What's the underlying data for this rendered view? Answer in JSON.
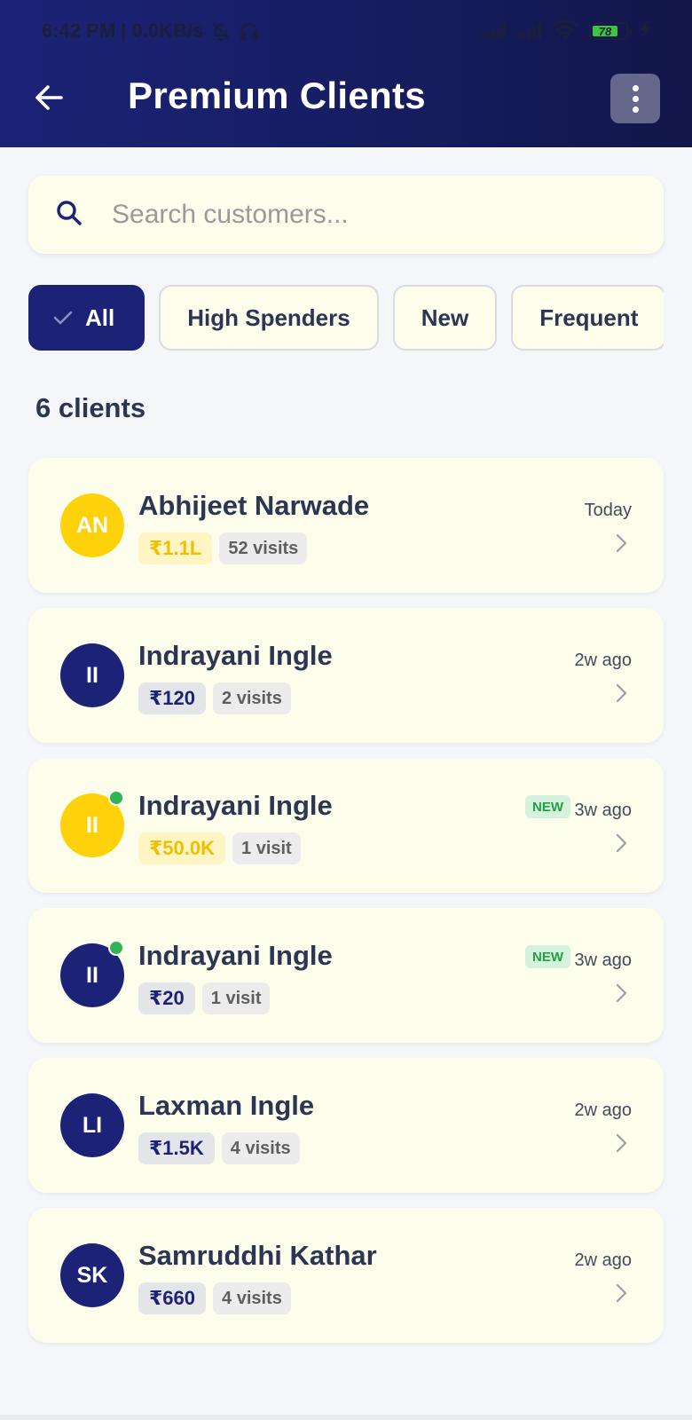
{
  "status_bar": {
    "time_text": "6:42 PM | 0.0KB/s",
    "battery_level": "78",
    "icons": [
      "bell-off-icon",
      "headphones-icon",
      "signal-icon",
      "signal-icon",
      "wifi-icon",
      "battery-icon",
      "charging-icon"
    ]
  },
  "header": {
    "title": "Premium Clients",
    "back_icon": "arrow-left-icon",
    "menu_icon": "more-vertical-icon",
    "background_color": "#1c2377"
  },
  "search": {
    "placeholder": "Search customers...",
    "value": "",
    "icon": "search-icon"
  },
  "filters": [
    {
      "label": "All",
      "active": true,
      "icon": "check-icon"
    },
    {
      "label": "High Spenders",
      "active": false
    },
    {
      "label": "New",
      "active": false
    },
    {
      "label": "Frequent",
      "active": false
    }
  ],
  "client_count": "6 clients",
  "clients": [
    {
      "initials": "AN",
      "name": "Abhijeet Narwade",
      "amount": "₹1.1L",
      "visits": "52 visits",
      "time": "Today",
      "badge": "",
      "avatar_color": "gold",
      "online": false
    },
    {
      "initials": "II",
      "name": "Indrayani Ingle",
      "amount": "₹120",
      "visits": "2 visits",
      "time": "2w ago",
      "badge": "",
      "avatar_color": "navy",
      "online": false
    },
    {
      "initials": "II",
      "name": "Indrayani Ingle",
      "amount": "₹50.0K",
      "visits": "1 visit",
      "time": "3w ago",
      "badge": "NEW",
      "avatar_color": "gold",
      "online": true
    },
    {
      "initials": "II",
      "name": "Indrayani Ingle",
      "amount": "₹20",
      "visits": "1 visit",
      "time": "3w ago",
      "badge": "NEW",
      "avatar_color": "navy",
      "online": true
    },
    {
      "initials": "LI",
      "name": "Laxman Ingle",
      "amount": "₹1.5K",
      "visits": "4 visits",
      "time": "2w ago",
      "badge": "",
      "avatar_color": "navy",
      "online": false
    },
    {
      "initials": "SK",
      "name": "Samruddhi Kathar",
      "amount": "₹660",
      "visits": "4 visits",
      "time": "2w ago",
      "badge": "",
      "avatar_color": "navy",
      "online": false
    }
  ],
  "colors": {
    "primary": "#1c2377",
    "gold": "#fdd20a",
    "card_bg": "#fdfdec",
    "new_badge": "#22a046"
  }
}
